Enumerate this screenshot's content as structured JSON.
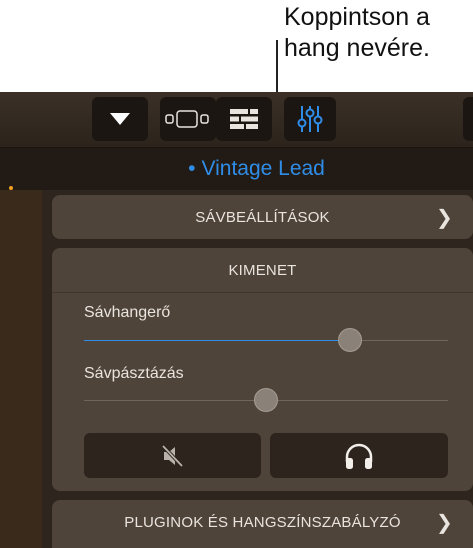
{
  "callout": {
    "text_line1": "Koppintson a",
    "text_line2": "hang nevére."
  },
  "toolbar": {
    "buttons": [
      "dropdown",
      "view-toggle",
      "tracks",
      "mixer"
    ]
  },
  "track": {
    "name": "Vintage Lead",
    "dot": "•"
  },
  "track_settings": {
    "label": "SÁVBEÁLLÍTÁSOK"
  },
  "output": {
    "title": "KIMENET",
    "volume_label": "Sávhangerő",
    "volume_value": 0.73,
    "pan_label": "Sávpásztázás",
    "pan_value": 0.5
  },
  "plugins": {
    "label": "PLUGINOK ÉS HANGSZÍNSZABÁLYZÓ"
  },
  "colors": {
    "accent": "#2f8de8",
    "panel": "#4f443a",
    "background": "#2e261e"
  }
}
